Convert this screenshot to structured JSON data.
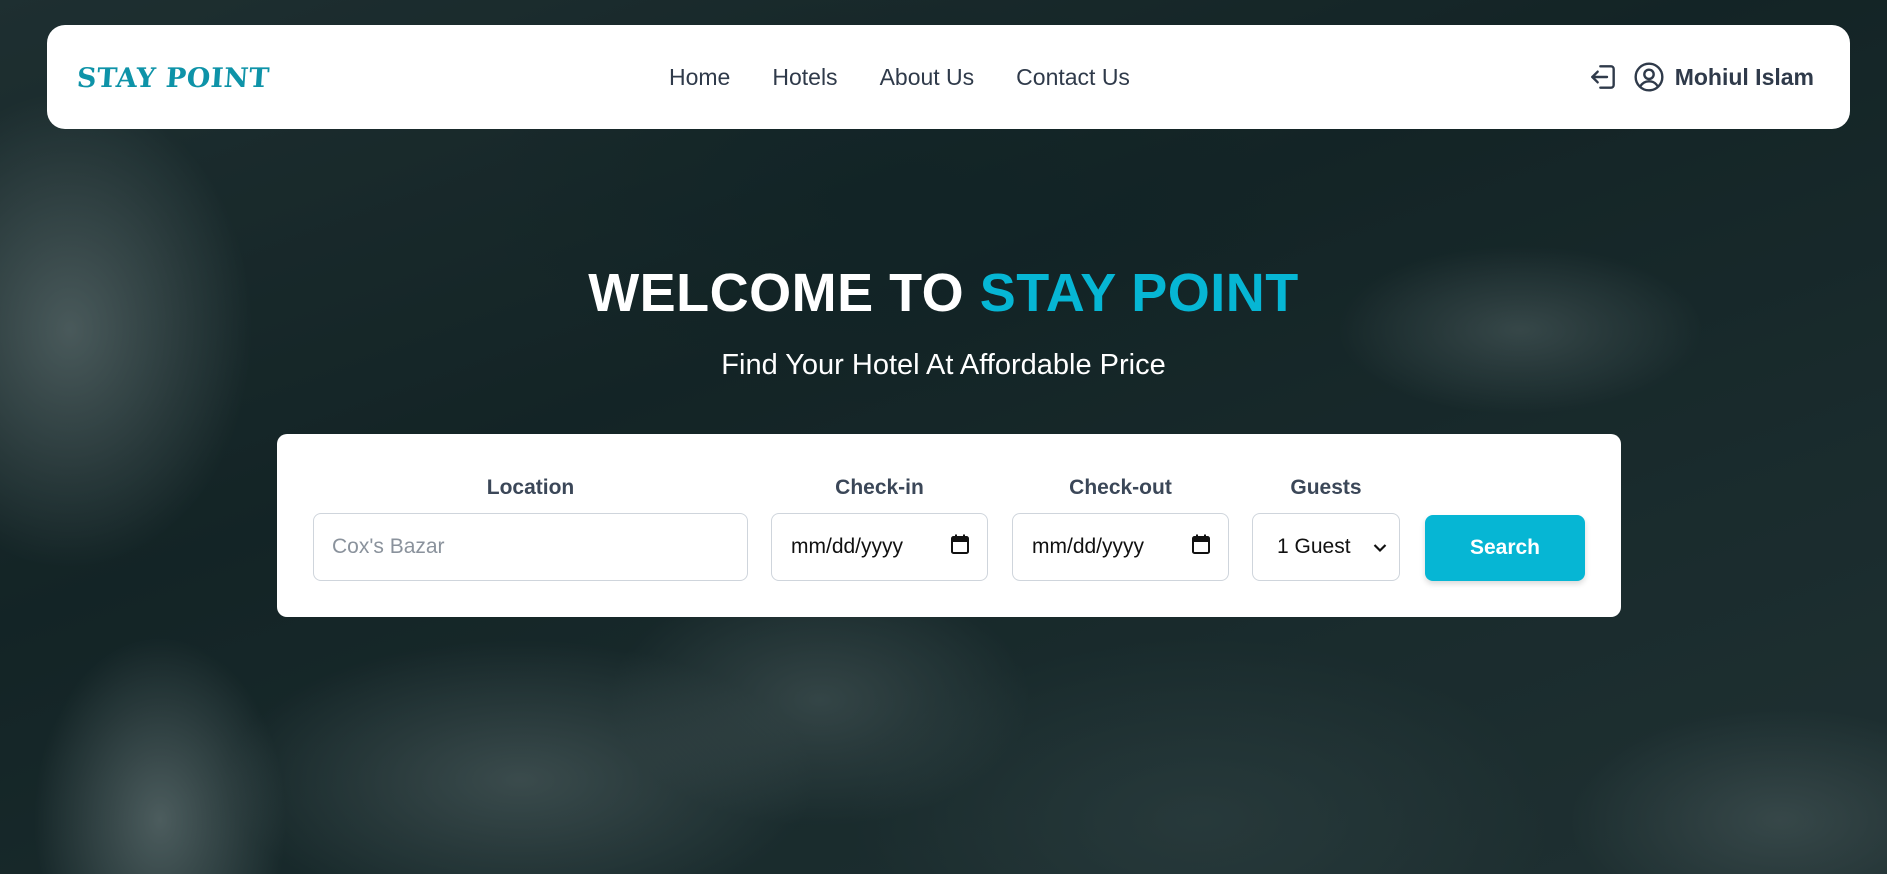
{
  "brand": {
    "logo_text": "STAY POINT"
  },
  "nav": {
    "links": [
      "Home",
      "Hotels",
      "About Us",
      "Contact Us"
    ]
  },
  "user": {
    "logout_icon": "logout-icon",
    "avatar_icon": "user-circle-icon",
    "name": "Mohiul Islam"
  },
  "hero": {
    "title_prefix": "WELCOME TO",
    "title_accent": "STAY POINT",
    "subtitle": "Find Your Hotel At Affordable Price"
  },
  "search": {
    "location_label": "Location",
    "location_placeholder": "Cox's Bazar",
    "checkin_label": "Check-in",
    "checkin_value": "mm/dd/yyyy",
    "checkout_label": "Check-out",
    "checkout_value": "mm/dd/yyyy",
    "guests_label": "Guests",
    "guests_selected": "1 Guest",
    "button_label": "Search"
  },
  "colors": {
    "accent": "#06b6d4",
    "logo": "#0e93a8",
    "text_dark": "#2f3a4a"
  }
}
